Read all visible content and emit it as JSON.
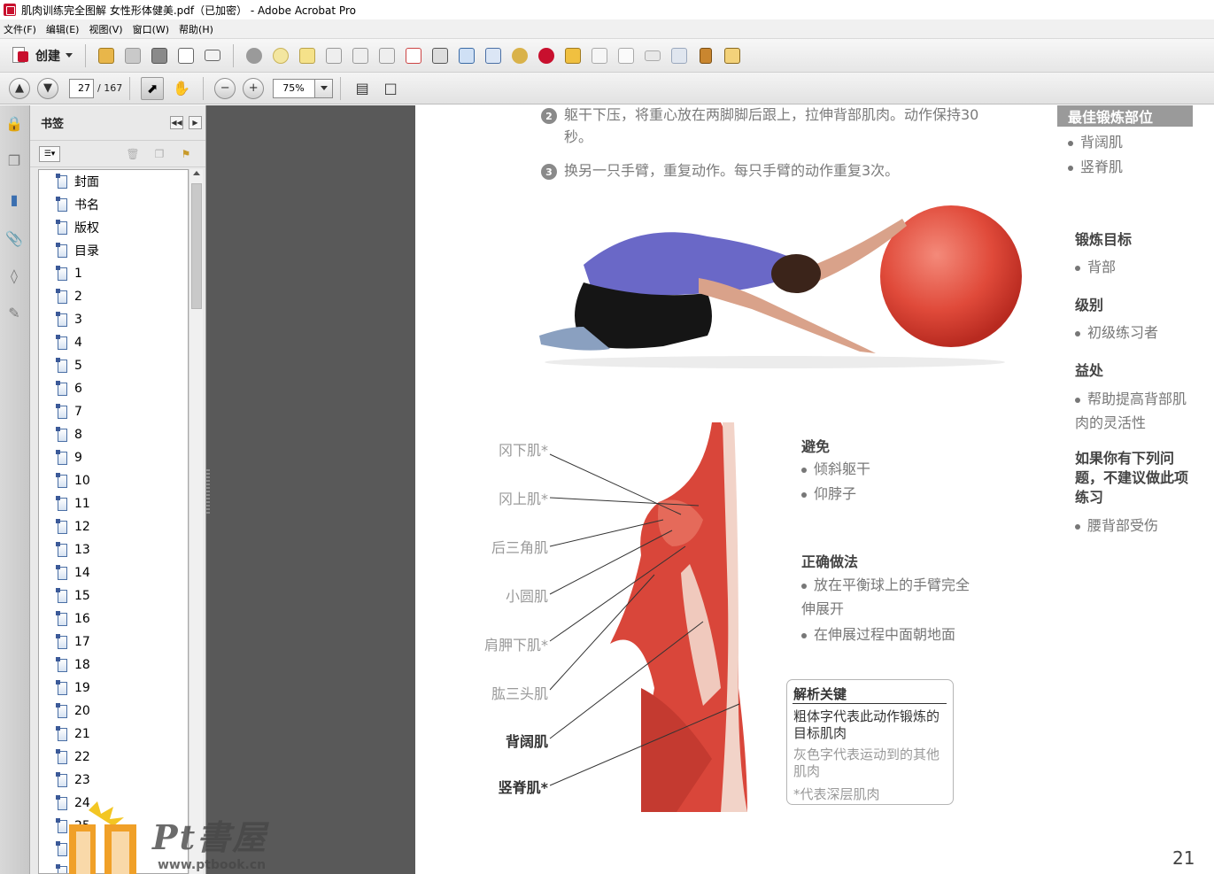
{
  "window": {
    "title": "肌肉训练完全图解 女性形体健美.pdf（已加密） - Adobe Acrobat Pro"
  },
  "menu": {
    "items": [
      "文件(F)",
      "编辑(E)",
      "视图(V)",
      "窗口(W)",
      "帮助(H)"
    ]
  },
  "toolbar": {
    "create_label": "创建"
  },
  "navigation": {
    "current_page": "27",
    "total_pages": "/ 167",
    "zoom": "75%"
  },
  "bookmarks": {
    "title": "书签",
    "items": [
      "封面",
      "书名",
      "版权",
      "目录",
      "1",
      "2",
      "3",
      "4",
      "5",
      "6",
      "7",
      "8",
      "9",
      "10",
      "11",
      "12",
      "13",
      "14",
      "15",
      "16",
      "17",
      "18",
      "19",
      "20",
      "21",
      "22",
      "23",
      "24",
      "25",
      "26",
      "27"
    ]
  },
  "page": {
    "step2_num": "2",
    "step2_text": "躯干下压，将重心放在两脚脚后跟上，拉伸背部肌肉。动作保持30秒。",
    "step3_num": "3",
    "step3_text": "换另一只手臂，重复动作。每只手臂的动作重复3次。",
    "best_banner": "最佳锻炼部位",
    "best_items": [
      "背阔肌",
      "竖脊肌"
    ],
    "target_heading": "锻炼目标",
    "target_items": [
      "背部"
    ],
    "level_heading": "级别",
    "level_items": [
      "初级练习者"
    ],
    "benefit_heading": "益处",
    "benefit_items": [
      "帮助提高背部肌肉的灵活性"
    ],
    "warning_heading": "如果你有下列问题，不建议做此项练习",
    "warning_items": [
      "腰背部受伤"
    ],
    "avoid_heading": "避免",
    "avoid_items": [
      "倾斜躯干",
      "仰脖子"
    ],
    "correct_heading": "正确做法",
    "correct_items": [
      "放在平衡球上的手臂完全伸展开",
      "在伸展过程中面朝地面"
    ],
    "muscle_labels": [
      {
        "text": "冈下肌*",
        "style": "grey"
      },
      {
        "text": "冈上肌*",
        "style": "grey"
      },
      {
        "text": "后三角肌",
        "style": "grey"
      },
      {
        "text": "小圆肌",
        "style": "grey"
      },
      {
        "text": "肩胛下肌*",
        "style": "grey"
      },
      {
        "text": "肱三头肌",
        "style": "grey"
      },
      {
        "text": "背阔肌",
        "style": "bold"
      },
      {
        "text": "竖脊肌*",
        "style": "bold"
      }
    ],
    "key_title": "解析关键",
    "key_bold": "粗体字代表此动作锻炼的目标肌肉",
    "key_grey": "灰色字代表运动到的其他肌肉",
    "key_deep": "*代表深层肌肉",
    "page_number": "21"
  },
  "watermark": {
    "text": "Pt書屋",
    "url": "www.ptbook.cn"
  }
}
